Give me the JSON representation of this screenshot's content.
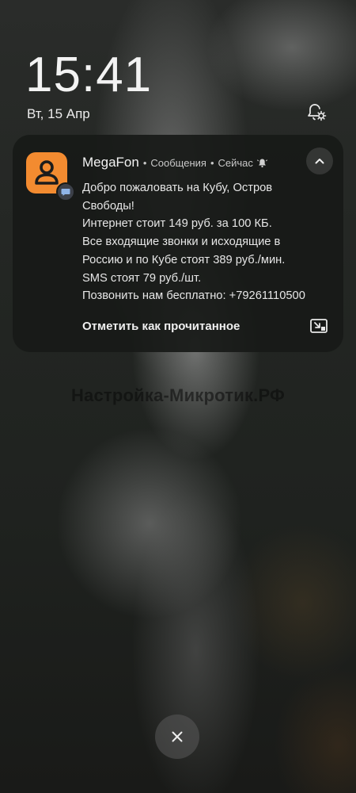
{
  "lockscreen": {
    "time": "15:41",
    "date": "Вт, 15 Апр",
    "settings_icon": "notification-settings-icon"
  },
  "notification": {
    "app_name": "MegaFon",
    "channel": "Сообщения",
    "time": "Сейчас",
    "separator": "•",
    "app_icon": "contact-person-icon",
    "badge_icon": "message-badge-icon",
    "bell_icon": "bell-ringing-icon",
    "collapse_icon": "chevron-up-icon",
    "app_color": "#f38b30",
    "lines": [
      "Добро пожаловать на Кубу, Остров",
      "Свободы!",
      "Интернет стоит 149 руб. за 100 КБ.",
      "Все входящие звонки и исходящие в",
      "Россию и по Кубе стоят 389 руб./мин.",
      "SMS стоят 79 руб./шт.",
      "Позвонить нам бесплатно: +79261110500"
    ],
    "action_label": "Отметить как прочитанное",
    "cast_icon": "cast-to-screen-icon"
  },
  "watermark": "Настройка-Микротик.РФ",
  "dismiss": {
    "icon": "close-icon"
  }
}
